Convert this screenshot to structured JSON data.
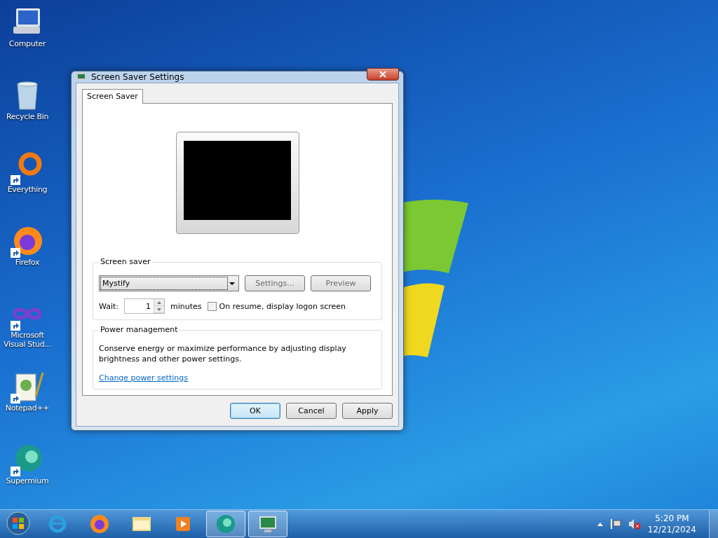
{
  "desktop_icons": [
    {
      "label": "Computer",
      "kind": "computer",
      "shortcut": false
    },
    {
      "label": "Recycle Bin",
      "kind": "bin",
      "shortcut": false
    },
    {
      "label": "Everything",
      "kind": "ring",
      "shortcut": true
    },
    {
      "label": "Firefox",
      "kind": "firefox",
      "shortcut": true
    },
    {
      "label": "Microsoft Visual Stud...",
      "kind": "infinity",
      "shortcut": true
    },
    {
      "label": "Notepad++",
      "kind": "notepad",
      "shortcut": true
    },
    {
      "label": "Supermium",
      "kind": "supermium",
      "shortcut": true
    }
  ],
  "dialog": {
    "title": "Screen Saver Settings",
    "tabs": [
      {
        "label": "Screen Saver",
        "selected": true
      }
    ],
    "screen_saver_group": {
      "legend": "Screen saver",
      "dropdown": {
        "value": "Mystify"
      },
      "buttons": [
        "Settings...",
        "Preview"
      ],
      "wait_label": "Wait:",
      "wait_value": "1",
      "minutes_label": "minutes",
      "logon_checkbox": {
        "label": "On resume, display logon screen",
        "checked": false
      }
    },
    "power_group": {
      "legend": "Power management",
      "description": "Conserve energy or maximize performance by adjusting display brightness and other power settings.",
      "link": "Change power settings"
    },
    "buttons": [
      {
        "label": "OK",
        "default": true
      },
      {
        "label": "Cancel",
        "default": false
      },
      {
        "label": "Apply",
        "default": false
      }
    ]
  },
  "taskbar": {
    "items": [
      {
        "kind": "ie",
        "active": false
      },
      {
        "kind": "firefox",
        "active": false
      },
      {
        "kind": "folder",
        "active": false
      },
      {
        "kind": "media",
        "active": false
      },
      {
        "kind": "supermium",
        "active": true
      },
      {
        "kind": "display",
        "active": true
      }
    ],
    "clock": {
      "time": "5:20 PM",
      "date": "12/21/2024"
    }
  }
}
